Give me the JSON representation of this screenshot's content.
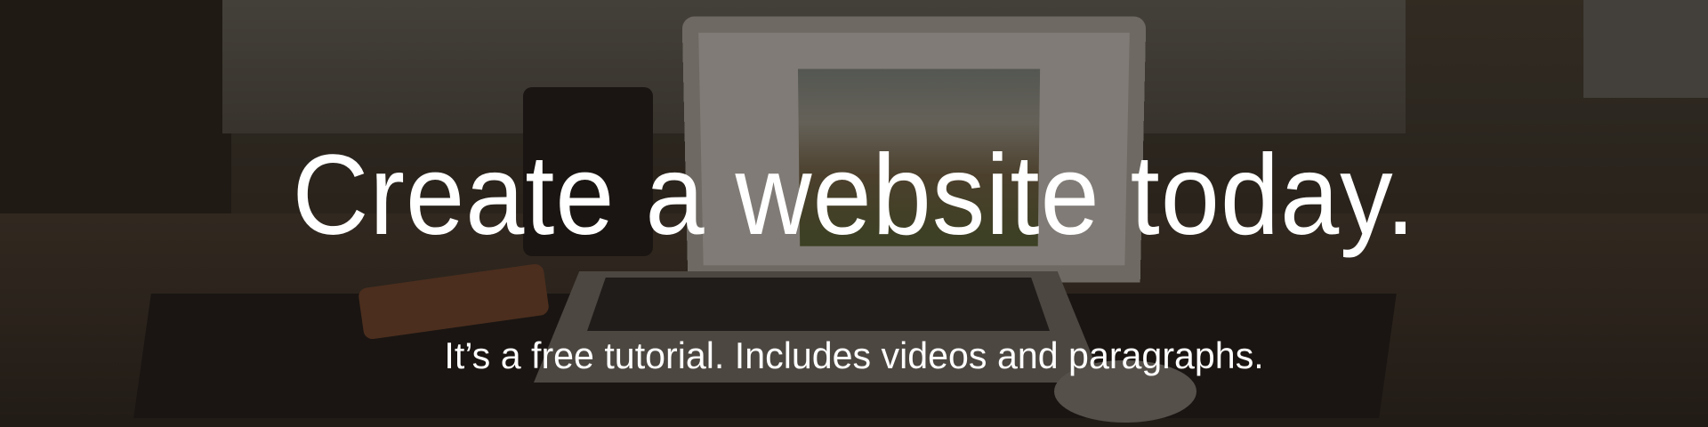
{
  "hero": {
    "title": "Create a website today.",
    "subtitle": "It’s a free tutorial. Includes videos and paragraphs."
  },
  "colors": {
    "text": "#ffffff",
    "overlay": "#140e08"
  }
}
